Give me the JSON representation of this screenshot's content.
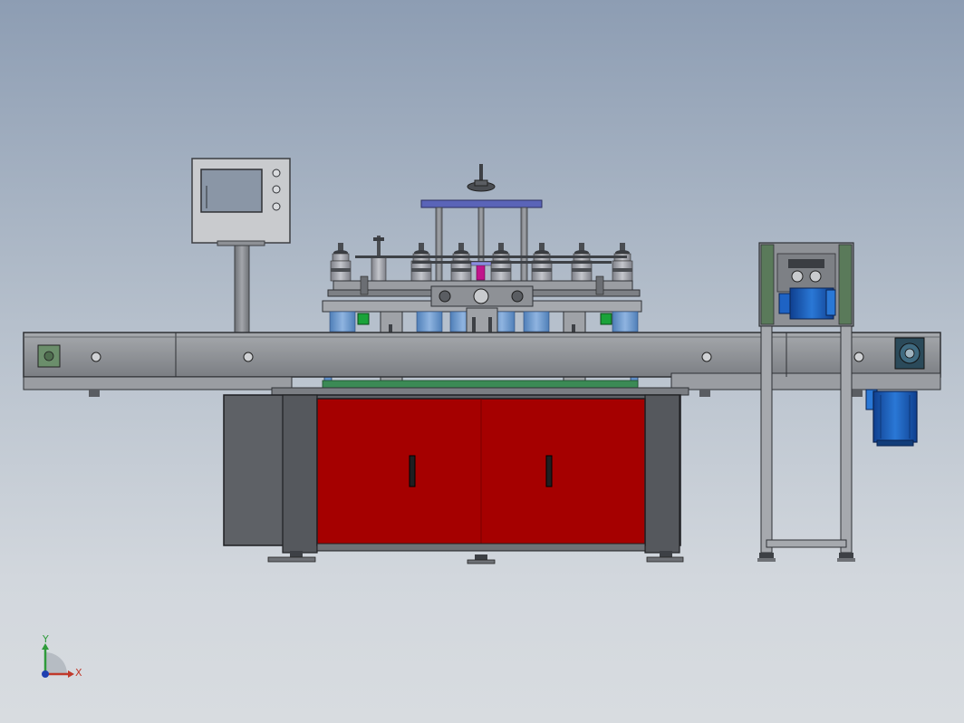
{
  "viewport": {
    "background_top": "#8d9db3",
    "background_bottom": "#d8dce0"
  },
  "triad": {
    "x_label": "X",
    "y_label": "Y",
    "x_color": "#c0392b",
    "y_color": "#2e9b3a",
    "z_color": "#1f3fb0"
  },
  "colors": {
    "frame_steel": "#8e9196",
    "frame_dark": "#5a5d62",
    "cabinet_red": "#a50000",
    "cabinet_gray": "#5e6166",
    "motor_blue": "#1e63c4",
    "top_plate_blue": "#5a64b8",
    "hmi_screen": "#8a96a6",
    "belt_green": "#3b8a55",
    "indicator_green": "#1aa33a",
    "magenta_part": "#c0158c"
  },
  "components": {
    "hmi_panel": {
      "buttons": 3
    },
    "capping_heads": 8,
    "cabinet_doors": 2,
    "side_motor": 1,
    "frame_bolts": 4
  }
}
